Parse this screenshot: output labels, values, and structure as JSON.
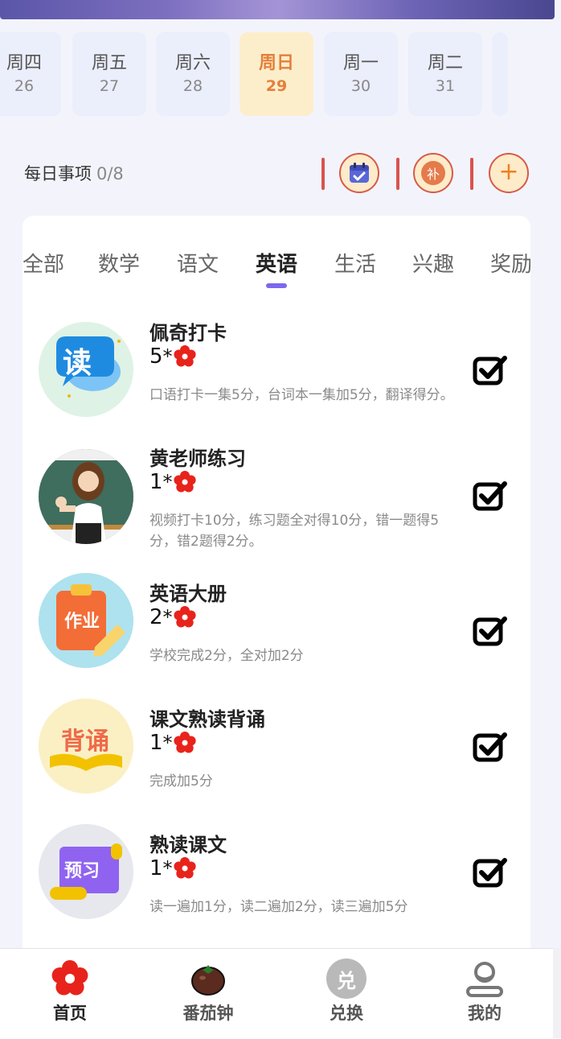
{
  "day_strip": [
    {
      "weekday": "周四",
      "date": "26",
      "selected": false
    },
    {
      "weekday": "周五",
      "date": "27",
      "selected": false
    },
    {
      "weekday": "周六",
      "date": "28",
      "selected": false
    },
    {
      "weekday": "周日",
      "date": "29",
      "selected": true
    },
    {
      "weekday": "周一",
      "date": "30",
      "selected": false
    },
    {
      "weekday": "周二",
      "date": "31",
      "selected": false
    }
  ],
  "daily": {
    "title": "每日事项",
    "count": "0/8",
    "makeup_label": "补",
    "add_label": "+"
  },
  "tabs": [
    "全部",
    "数学",
    "语文",
    "英语",
    "生活",
    "兴趣",
    "奖励"
  ],
  "active_tab": "英语",
  "tasks": [
    {
      "name": "佩奇打卡",
      "score": "5",
      "desc": "口语打卡一集5分，台词本一集加5分，翻译得分。",
      "checked": true,
      "icon": "read-icon"
    },
    {
      "name": "黄老师练习",
      "score": "1",
      "desc": "视频打卡10分，练习题全对得10分，错一题得5分，错2题得2分。",
      "checked": true,
      "icon": "teacher-icon"
    },
    {
      "name": "英语大册",
      "score": "2",
      "desc": "学校完成2分，全对加2分",
      "checked": true,
      "icon": "homework-icon"
    },
    {
      "name": "课文熟读背诵",
      "score": "1",
      "desc": "完成加5分",
      "checked": true,
      "icon": "recite-icon"
    },
    {
      "name": "熟读课文",
      "score": "1",
      "desc": "读一遍加1分，读二遍加2分，读三遍加5分",
      "checked": true,
      "icon": "preview-icon"
    }
  ],
  "icon_labels": {
    "read": "读",
    "homework": "作业",
    "recite": "背诵",
    "preview": "预习",
    "exchange": "兑"
  },
  "nav": [
    {
      "label": "首页",
      "icon": "flower-home-icon",
      "active": true
    },
    {
      "label": "番茄钟",
      "icon": "tomato-timer-icon",
      "active": false
    },
    {
      "label": "兑换",
      "icon": "exchange-icon",
      "active": false
    },
    {
      "label": "我的",
      "icon": "profile-icon",
      "active": false
    }
  ],
  "colors": {
    "accent": "#7b68ee",
    "selected_day_bg": "#fdeecb",
    "selected_day_text": "#e57f3c",
    "flower_red": "#e8231b",
    "tool_border": "#d75a4a"
  }
}
